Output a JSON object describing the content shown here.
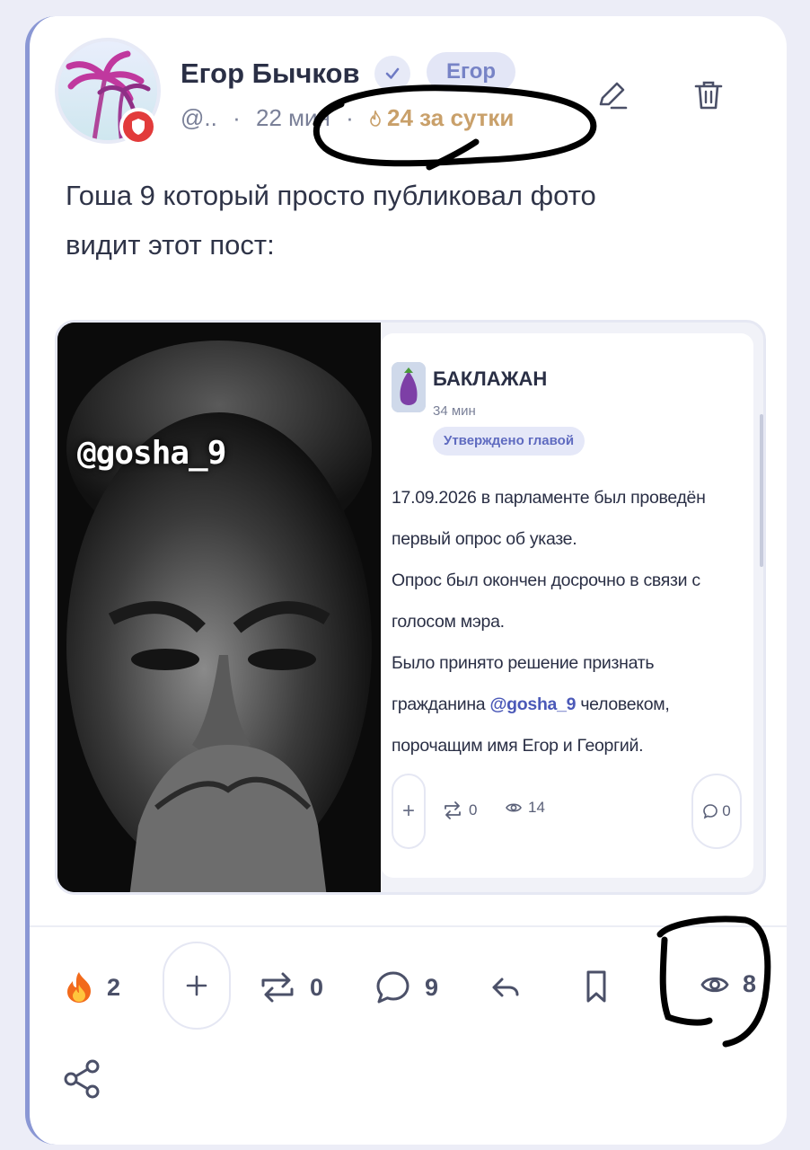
{
  "post": {
    "author_name": "Егор Бычков",
    "tag": "Егор",
    "handle": "@..",
    "separator": "·",
    "time": "22 мин",
    "trending": "24 за сутки",
    "text_line1": "Гоша 9 который просто публиковал фото",
    "text_line2": "видит этот пост:"
  },
  "embed": {
    "photo_caption": "@gosha_9",
    "name": "БАКЛАЖАН",
    "time": "34 мин",
    "badge": "Утверждено главой",
    "lines": [
      "17.09.2026 в парламенте был проведён",
      "первый опрос об указе.",
      "Опрос был окончен досрочно в связи с",
      "голосом мэра.",
      "Было принято решение признать"
    ],
    "line6_prefix": "гражданина ",
    "mention": "@gosha_9",
    "line6_suffix": " человеком,",
    "line7": "порочащим имя Егор и Георгий.",
    "plus": "+",
    "reposts": "0",
    "views": "14",
    "comments": "0"
  },
  "actions": {
    "reactions": "2",
    "reposts": "0",
    "comments": "9",
    "views": "8"
  },
  "colors": {
    "accent": "#5f6bc0",
    "gold": "#c9a06a",
    "danger": "#e23b3b"
  }
}
